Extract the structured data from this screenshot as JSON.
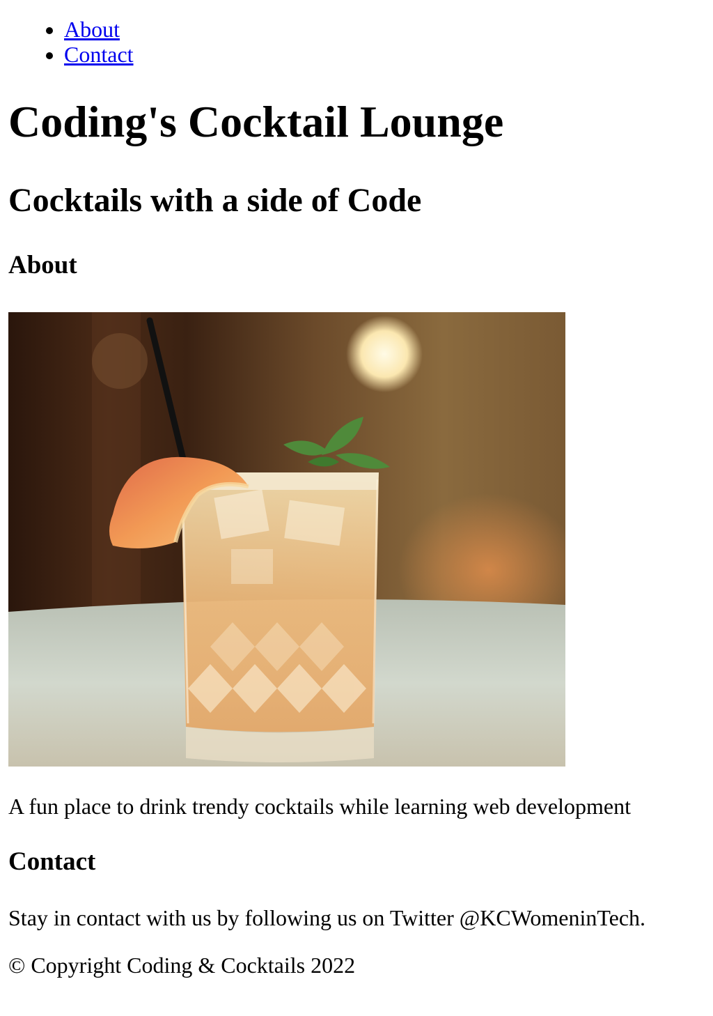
{
  "nav": {
    "items": [
      {
        "label": "About"
      },
      {
        "label": "Contact"
      }
    ]
  },
  "header": {
    "title": "Coding's Cocktail Lounge",
    "subtitle": "Cocktails with a side of Code"
  },
  "about": {
    "heading": "About",
    "image_icon": "cocktail-photo",
    "text": "A fun place to drink trendy cocktails while learning web development"
  },
  "contact": {
    "heading": "Contact",
    "text": "Stay in contact with us by following us on Twitter @KCWomeninTech."
  },
  "footer": {
    "copyright": "© Copyright Coding & Cocktails 2022"
  },
  "colors": {
    "link": "#0000ee",
    "text": "#000000",
    "background": "#ffffff"
  }
}
